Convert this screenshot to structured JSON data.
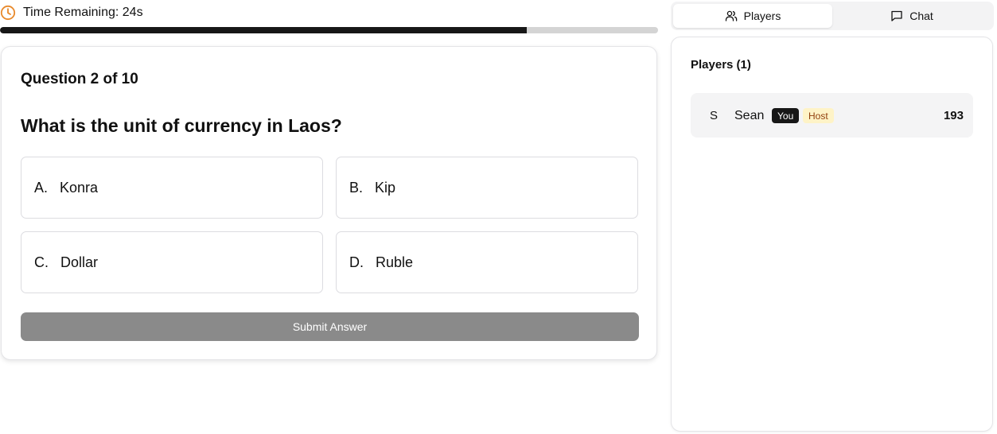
{
  "timer": {
    "label": "Time Remaining: 24s",
    "progress_fraction": 0.8,
    "icon": "clock-icon",
    "accent_color": "#e8892b"
  },
  "question": {
    "counter": "Question 2 of 10",
    "text": "What is the unit of currency in Laos?",
    "options": [
      {
        "letter": "A.",
        "label": "Konra"
      },
      {
        "letter": "B.",
        "label": "Kip"
      },
      {
        "letter": "C.",
        "label": "Dollar"
      },
      {
        "letter": "D.",
        "label": "Ruble"
      }
    ],
    "submit_label": "Submit Answer"
  },
  "tabs": {
    "players": {
      "label": "Players",
      "icon": "users-icon",
      "active": true
    },
    "chat": {
      "label": "Chat",
      "icon": "chat-icon",
      "active": false
    }
  },
  "players_panel": {
    "title": "Players (1)",
    "players": [
      {
        "initial": "S",
        "name": "Sean",
        "you_badge": "You",
        "host_badge": "Host",
        "score": "193"
      }
    ]
  }
}
